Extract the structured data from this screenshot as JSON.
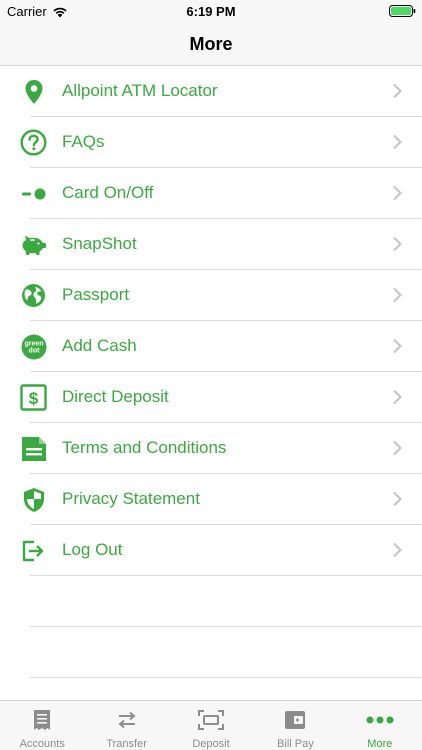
{
  "status_bar": {
    "carrier": "Carrier",
    "time": "6:19 PM"
  },
  "nav": {
    "title": "More"
  },
  "colors": {
    "accent": "#3aa93f",
    "chevron": "#c4c4c8",
    "tab_inactive": "#8c8c8c"
  },
  "menu": {
    "items": [
      {
        "label": "Allpoint ATM Locator",
        "icon": "location-pin-icon"
      },
      {
        "label": "FAQs",
        "icon": "question-circle-icon"
      },
      {
        "label": "Card On/Off",
        "icon": "toggle-switch-icon"
      },
      {
        "label": "SnapShot",
        "icon": "piggy-bank-icon"
      },
      {
        "label": "Passport",
        "icon": "globe-icon"
      },
      {
        "label": "Add Cash",
        "icon": "green-dot-logo-icon",
        "logo_text": "green dot"
      },
      {
        "label": "Direct Deposit",
        "icon": "dollar-document-icon"
      },
      {
        "label": "Terms and Conditions",
        "icon": "document-icon"
      },
      {
        "label": "Privacy Statement",
        "icon": "shield-icon"
      },
      {
        "label": "Log Out",
        "icon": "logout-icon"
      }
    ]
  },
  "tab_bar": {
    "tabs": [
      {
        "label": "Accounts",
        "icon": "receipt-icon",
        "active": false
      },
      {
        "label": "Transfer",
        "icon": "transfer-arrows-icon",
        "active": false
      },
      {
        "label": "Deposit",
        "icon": "check-scan-icon",
        "active": false
      },
      {
        "label": "Bill Pay",
        "icon": "wallet-icon",
        "active": false
      },
      {
        "label": "More",
        "icon": "more-dots-icon",
        "active": true
      }
    ]
  }
}
